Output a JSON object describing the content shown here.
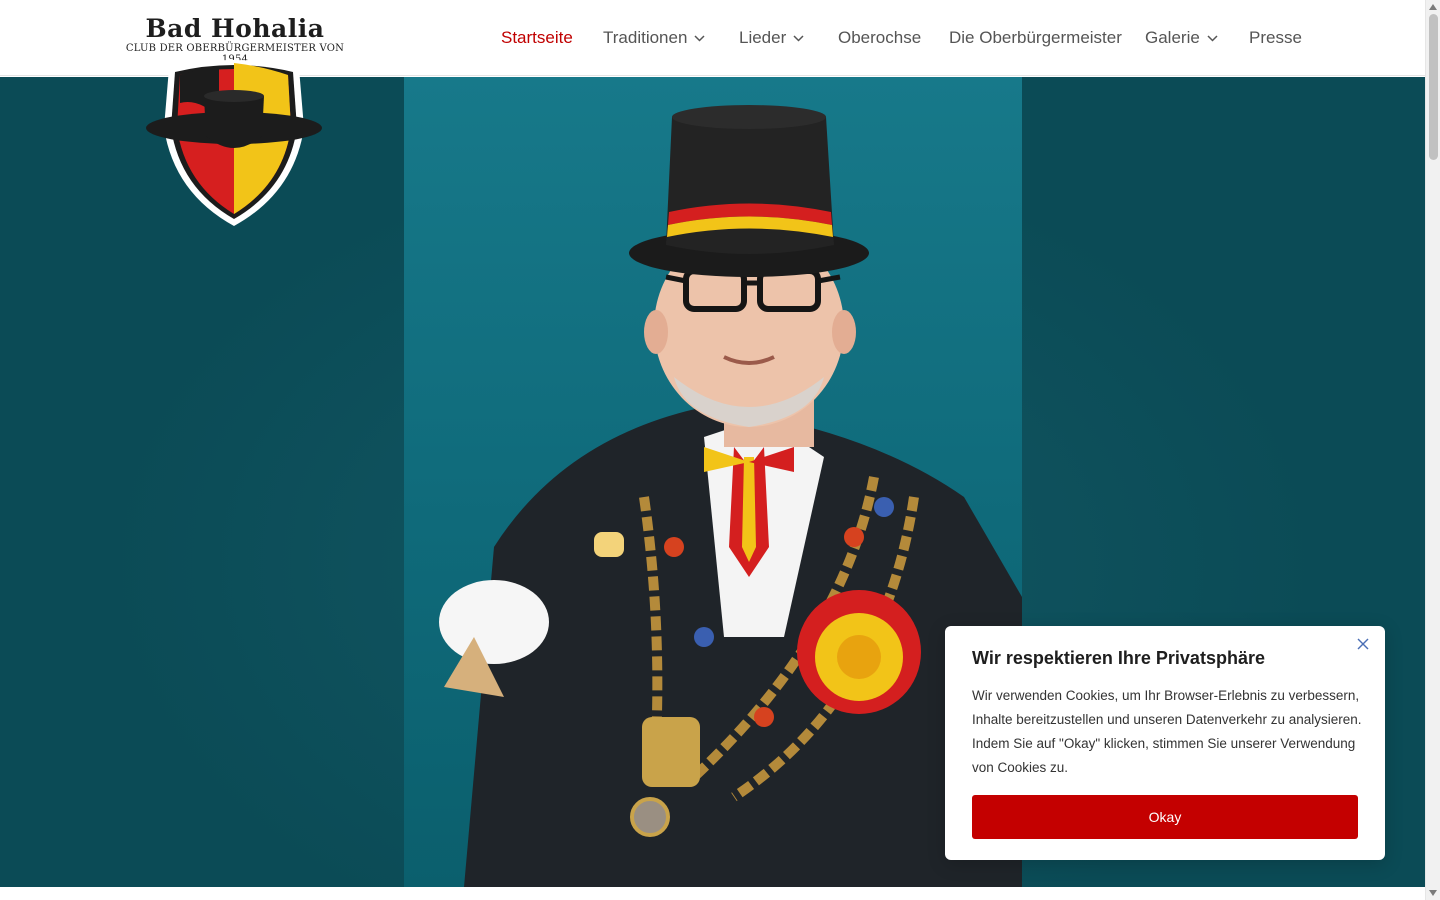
{
  "brand": {
    "title": "Bad Hohalia",
    "subtitle": "CLUB DER OBERBÜRGERMEISTER VON 1954"
  },
  "nav": {
    "items": [
      {
        "label": "Startseite",
        "active": true,
        "has_dropdown": false
      },
      {
        "label": "Traditionen",
        "active": false,
        "has_dropdown": true
      },
      {
        "label": "Lieder",
        "active": false,
        "has_dropdown": true
      },
      {
        "label": "Oberochse",
        "active": false,
        "has_dropdown": false
      },
      {
        "label": "Die Oberbürgermeister",
        "active": false,
        "has_dropdown": false
      },
      {
        "label": "Galerie",
        "active": false,
        "has_dropdown": true
      },
      {
        "label": "Presse",
        "active": false,
        "has_dropdown": false
      }
    ]
  },
  "hero": {
    "image_alt": "Oberbürgermeister mit Zylinder und Amtskette",
    "background_color": "#0b4b56"
  },
  "cookie": {
    "title": "Wir respektieren Ihre Privatsphäre",
    "text": "Wir verwenden Cookies, um Ihr Browser-Erlebnis zu verbessern, Inhalte bereitzustellen und unseren Datenverkehr zu analysieren. Indem Sie auf \"Okay\" klicken, stimmen Sie unserer Verwendung von Cookies zu.",
    "button_label": "Okay",
    "close_icon": "close-icon"
  },
  "colors": {
    "accent": "#c00000",
    "nav_text": "#555555",
    "hero_bg": "#0b4b56"
  }
}
